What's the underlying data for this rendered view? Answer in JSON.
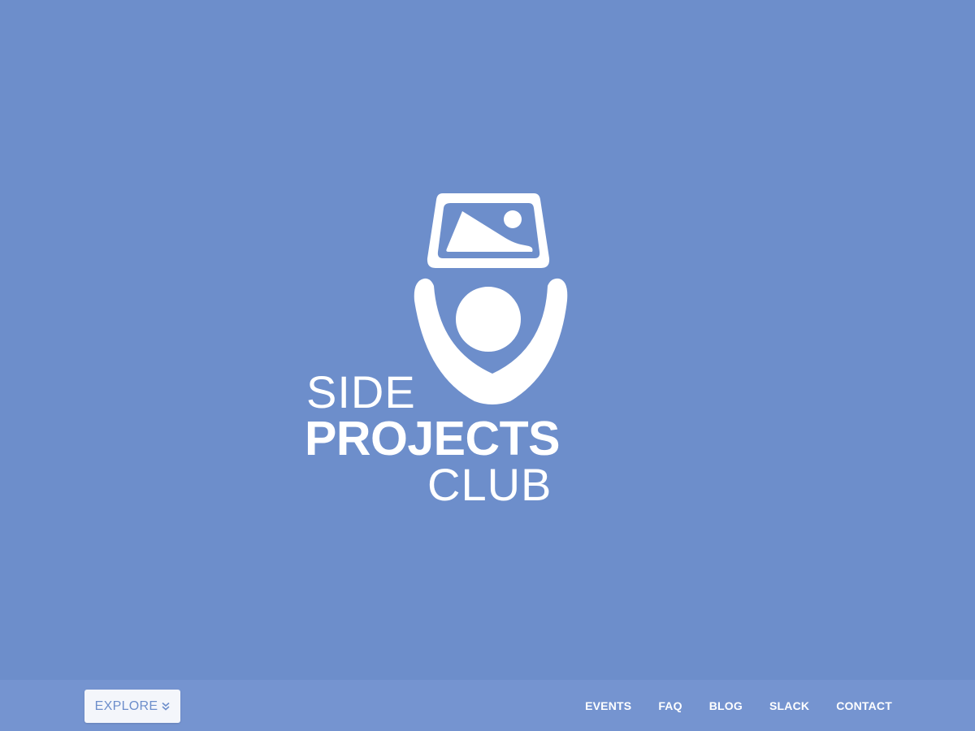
{
  "logo": {
    "line1": "SIDE",
    "line2": "PROJECTS",
    "line3": "CLUB",
    "icon": "person-holding-picture-icon"
  },
  "navbar": {
    "explore_label": "EXPLORE",
    "explore_icon": "double-chevron-down-icon",
    "links": [
      "EVENTS",
      "FAQ",
      "BLOG",
      "SLACK",
      "CONTACT"
    ]
  },
  "colors": {
    "background": "#6d8ecb",
    "navbar": "#7594d0",
    "button_bg": "#f4f6fb",
    "foreground": "#ffffff"
  }
}
